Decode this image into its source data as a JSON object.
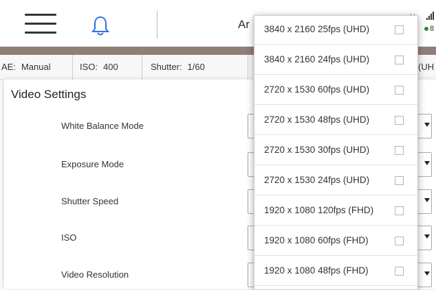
{
  "header": {
    "title_partial": "Ar",
    "right_ticks": "| |",
    "battery_partial": "8"
  },
  "statusbar": {
    "ae": {
      "key": "AE:",
      "value": "Manual"
    },
    "iso": {
      "key": "ISO:",
      "value": "400"
    },
    "shutter": {
      "key": "Shutter:",
      "value": "1/60"
    },
    "resolution_partial": "(UH"
  },
  "panel": {
    "title": "Video Settings",
    "rows": [
      {
        "label": "White Balance Mode"
      },
      {
        "label": "Exposure Mode"
      },
      {
        "label": "Shutter Speed"
      },
      {
        "label": "ISO"
      },
      {
        "label": "Video Resolution"
      }
    ]
  },
  "dropdown": {
    "options": [
      {
        "label": "3840 x 2160 25fps (UHD)",
        "checked": false
      },
      {
        "label": "3840 x 2160 24fps (UHD)",
        "checked": false
      },
      {
        "label": "2720 x 1530 60fps (UHD)",
        "checked": false
      },
      {
        "label": "2720 x 1530 48fps (UHD)",
        "checked": false
      },
      {
        "label": "2720 x 1530 30fps (UHD)",
        "checked": false
      },
      {
        "label": "2720 x 1530 24fps (UHD)",
        "checked": false
      },
      {
        "label": "1920 x 1080 120fps (FHD)",
        "checked": false
      },
      {
        "label": "1920 x 1080 60fps (FHD)",
        "checked": false
      },
      {
        "label": "1920 x 1080 48fps (FHD)",
        "checked": false
      }
    ]
  },
  "icons": {
    "menu": "hamburger-menu-icon",
    "notifications": "bell-icon",
    "signal": "signal-bars-icon",
    "dropdown_arrow": "caret-down-icon",
    "checkbox": "checkbox-icon"
  },
  "colors": {
    "accent_strip": "#8f7f76",
    "bell": "#2f6fe0",
    "battery": "#2a8a2a"
  }
}
